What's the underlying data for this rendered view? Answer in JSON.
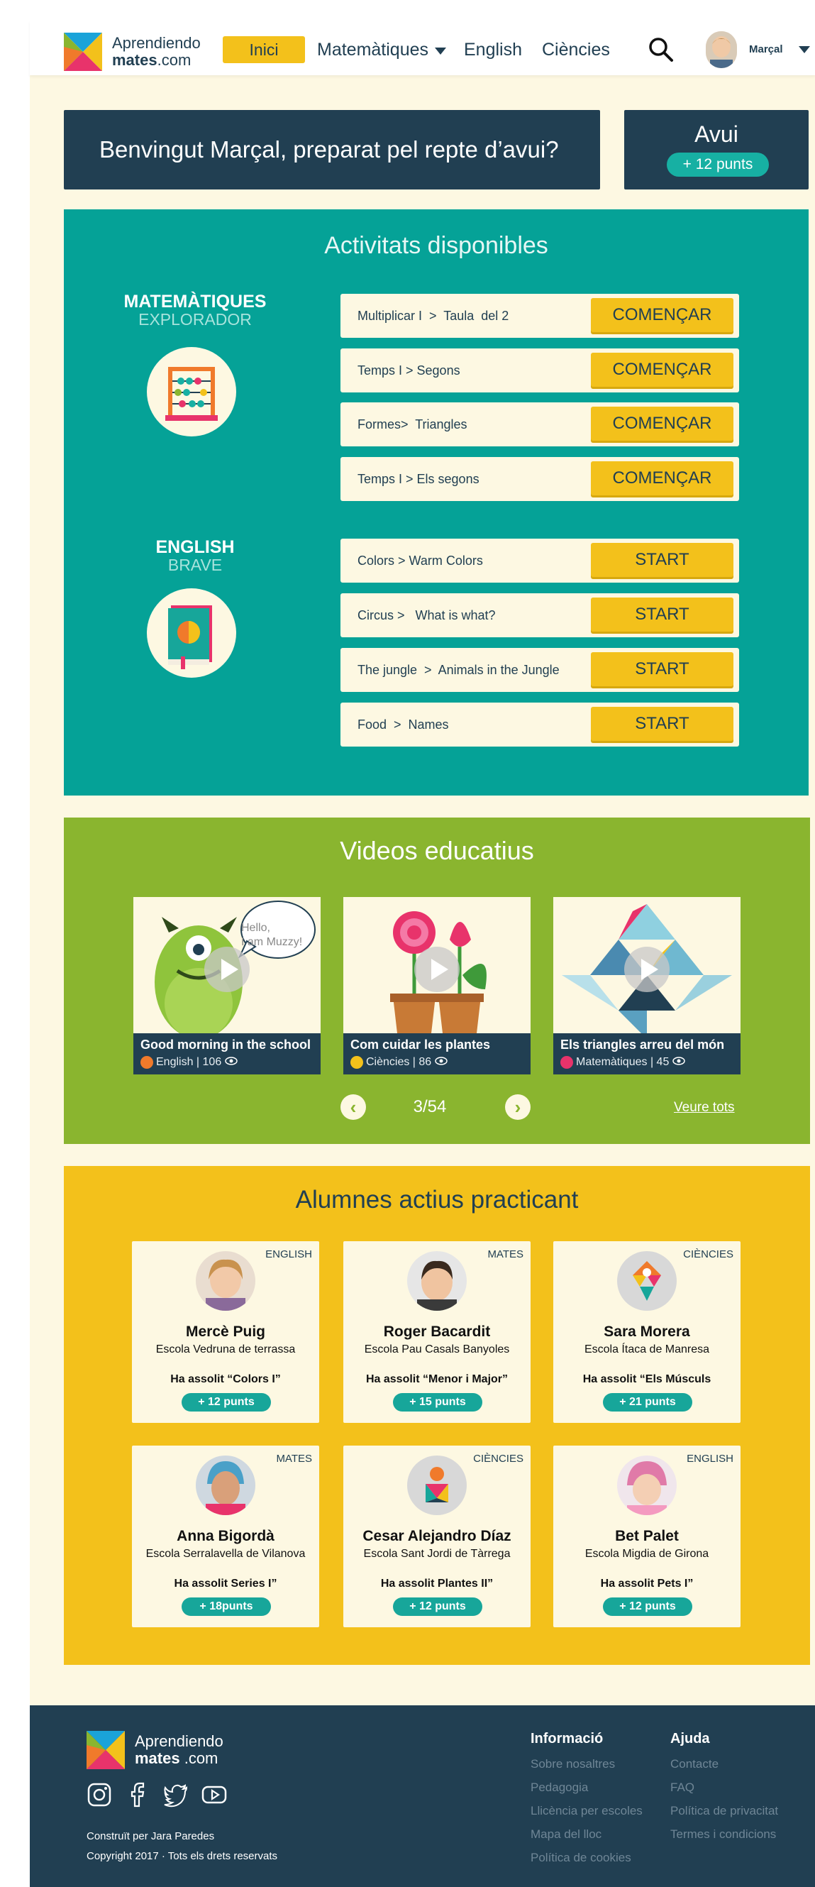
{
  "header": {
    "logo_line1": "Aprendiendo",
    "logo_line2a": "mates",
    "logo_line2b": ".com",
    "nav": {
      "home": "Inici",
      "maths": "Matemàtiques",
      "english": "English",
      "science": "Ciències"
    },
    "user": "Marçal"
  },
  "welcome": {
    "text": "Benvingut Marçal, preparat pel repte d’avui?",
    "today_title": "Avui",
    "today_points": "+ 12 punts"
  },
  "activities": {
    "title": "Activitats disponibles",
    "maths": {
      "subject": "MATEMÀTIQUES",
      "level": "EXPLORADOR",
      "items": [
        {
          "label": "Multiplicar I  >  Taula  del 2",
          "button": "COMENÇAR"
        },
        {
          "label": "Temps I > Segons",
          "button": "COMENÇAR"
        },
        {
          "label": "Formes>  Triangles",
          "button": "COMENÇAR"
        },
        {
          "label": "Temps I > Els segons",
          "button": "COMENÇAR"
        }
      ]
    },
    "english": {
      "subject": "ENGLISH",
      "level": "BRAVE",
      "items": [
        {
          "label": "Colors > Warm Colors",
          "button": "START"
        },
        {
          "label": "Circus >   What is what?",
          "button": "START"
        },
        {
          "label": "The jungle  >  Animals in the Jungle",
          "button": "START"
        },
        {
          "label": "Food  >  Names",
          "button": "START"
        }
      ]
    }
  },
  "videos": {
    "title": "Videos educatius",
    "items": [
      {
        "title": "Good morning in the school",
        "meta": "English | 106",
        "bubble_line1": "Hello,",
        "bubble_line2": "I am Muzzy!"
      },
      {
        "title": "Com cuidar les plantes",
        "meta": "Ciències | 86"
      },
      {
        "title": "Els triangles arreu del món",
        "meta": "Matemàtiques | 45"
      }
    ],
    "prev": "‹",
    "next": "›",
    "page": "3/54",
    "see_all": "Veure tots"
  },
  "students": {
    "title": "Alumnes actius practicant",
    "items": [
      {
        "subject": "ENGLISH",
        "name": "Mercè Puig",
        "school": "Escola Vedruna de terrassa",
        "achievement": "Ha assolit “Colors I”",
        "points": "+ 12 punts"
      },
      {
        "subject": "MATES",
        "name": "Roger Bacardit",
        "school": "Escola Pau Casals Banyoles",
        "achievement": "Ha assolit “Menor i Major”",
        "points": "+ 15 punts"
      },
      {
        "subject": "CIÈNCIES",
        "name": "Sara Morera",
        "school": "Escola Ítaca de Manresa",
        "achievement": "Ha assolit “Els Músculs",
        "points": "+ 21 punts"
      },
      {
        "subject": "MATES",
        "name": "Anna Bigordà",
        "school": "Escola Serralavella de Vilanova",
        "achievement": "Ha assolit Series I”",
        "points": "+ 18punts"
      },
      {
        "subject": "CIÈNCIES",
        "name": "Cesar Alejandro Díaz",
        "school": "Escola Sant Jordi de Tàrrega",
        "achievement": "Ha assolit Plantes II”",
        "points": "+ 12 punts"
      },
      {
        "subject": "ENGLISH",
        "name": "Bet Palet",
        "school": "Escola Migdia de Girona",
        "achievement": "Ha assolit Pets I”",
        "points": "+ 12 punts"
      }
    ]
  },
  "footer": {
    "logo_line1": "Aprendiendo",
    "logo_line2a": "mates",
    "logo_line2b": " .com",
    "built_by": "Construït per Jara Paredes",
    "copyright": "Copyright 2017 · Tots els drets reservats",
    "info": {
      "title": "Informació",
      "links": [
        "Sobre nosaltres",
        "Pedagogia",
        "Llicència per escoles",
        "Mapa del lloc",
        "Política de cookies"
      ]
    },
    "help": {
      "title": "Ajuda",
      "links": [
        "Contacte",
        "FAQ",
        "Política de privacitat",
        "Termes i condicions"
      ]
    }
  },
  "colors": {
    "navy": "#213f52",
    "yellow": "#f3c11b",
    "teal": "#05a297",
    "green": "#8ab52f",
    "cream": "#fdf8e2",
    "badge": "#17b0a3"
  },
  "icons": [
    "search-icon",
    "caret-down-icon",
    "play-icon",
    "eye-icon",
    "instagram-icon",
    "facebook-icon",
    "twitter-icon",
    "youtube-icon",
    "abacus-icon",
    "book-icon"
  ]
}
